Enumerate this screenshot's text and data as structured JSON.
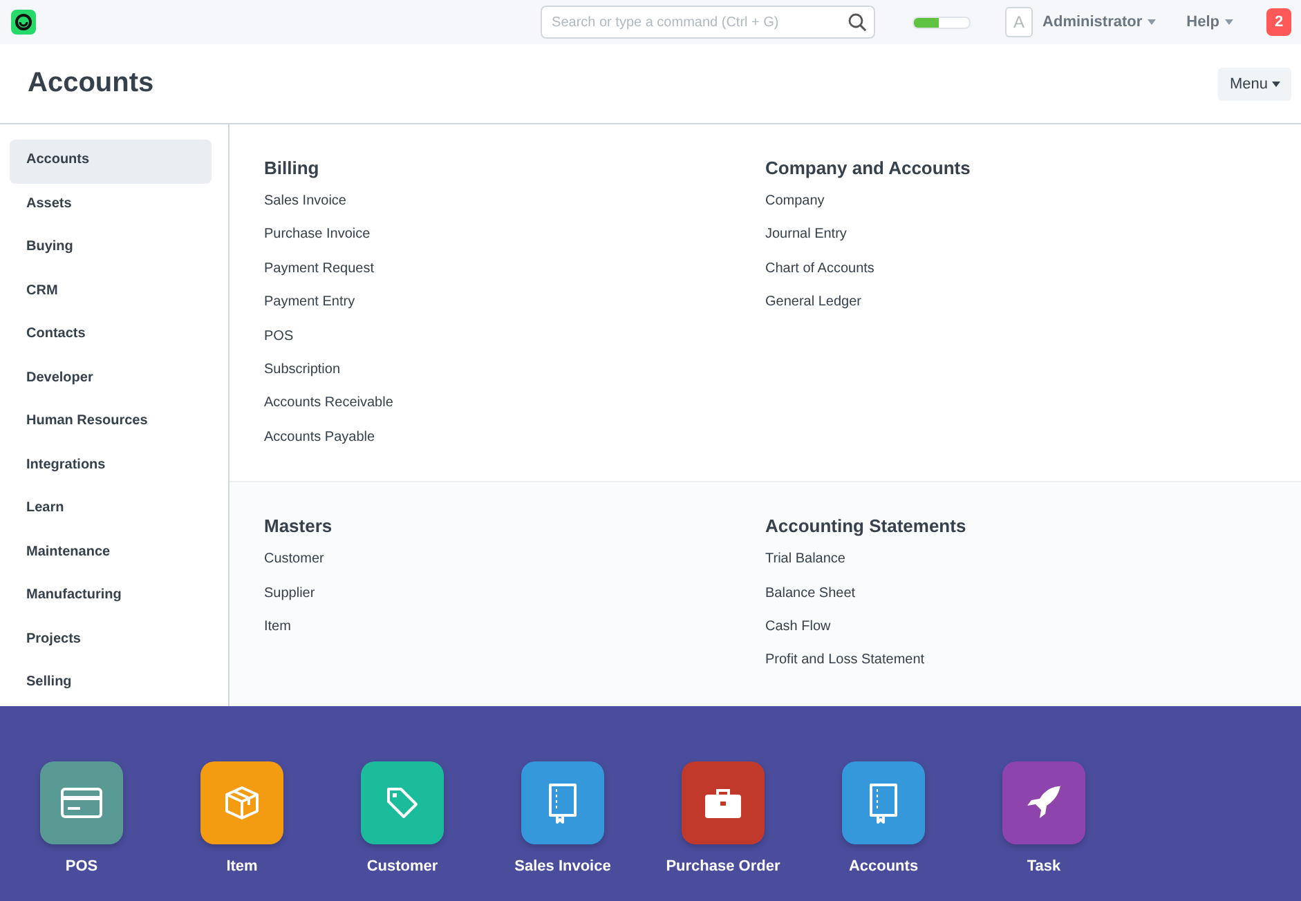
{
  "navbar": {
    "search": {
      "placeholder": "Search or type a command (Ctrl + G)"
    },
    "progress": {
      "level": 0.45
    },
    "avatar": "A",
    "user": "Administrator",
    "help": "Help",
    "notifications": "2"
  },
  "page": {
    "title": "Accounts",
    "menu": "Menu"
  },
  "sidebar": {
    "items": [
      {
        "label": "Accounts",
        "selected": true
      },
      {
        "label": "Assets",
        "selected": false
      },
      {
        "label": "Buying",
        "selected": false
      },
      {
        "label": "CRM",
        "selected": false
      },
      {
        "label": "Contacts",
        "selected": false
      },
      {
        "label": "Developer",
        "selected": false
      },
      {
        "label": "Human Resources",
        "selected": false
      },
      {
        "label": "Integrations",
        "selected": false
      },
      {
        "label": "Learn",
        "selected": false
      },
      {
        "label": "Maintenance",
        "selected": false
      },
      {
        "label": "Manufacturing",
        "selected": false
      },
      {
        "label": "Projects",
        "selected": false
      },
      {
        "label": "Selling",
        "selected": false
      }
    ]
  },
  "sections": [
    {
      "cards": [
        {
          "title": "Billing",
          "links": [
            "Sales Invoice",
            "Purchase Invoice",
            "Payment Request",
            "Payment Entry",
            "POS",
            "Subscription",
            "Accounts Receivable",
            "Accounts Payable"
          ]
        },
        {
          "title": "Company and Accounts",
          "links": [
            "Company",
            "Journal Entry",
            "Chart of Accounts",
            "General Ledger"
          ]
        }
      ]
    },
    {
      "cards": [
        {
          "title": "Masters",
          "links": [
            "Customer",
            "Supplier",
            "Item"
          ]
        },
        {
          "title": "Accounting Statements",
          "links": [
            "Trial Balance",
            "Balance Sheet",
            "Cash Flow",
            "Profit and Loss Statement"
          ]
        }
      ]
    }
  ],
  "dock": [
    {
      "label": "POS",
      "kind": "card",
      "color": "#5a9a94"
    },
    {
      "label": "Item",
      "kind": "box",
      "color": "#f39c12"
    },
    {
      "label": "Customer",
      "kind": "tag",
      "color": "#1abc9c"
    },
    {
      "label": "Sales Invoice",
      "kind": "book",
      "color": "#3498db"
    },
    {
      "label": "Purchase Order",
      "kind": "briefcase",
      "color": "#c0392b"
    },
    {
      "label": "Accounts",
      "kind": "book",
      "color": "#3498db"
    },
    {
      "label": "Task",
      "kind": "rocket",
      "color": "#8e44ad"
    }
  ]
}
